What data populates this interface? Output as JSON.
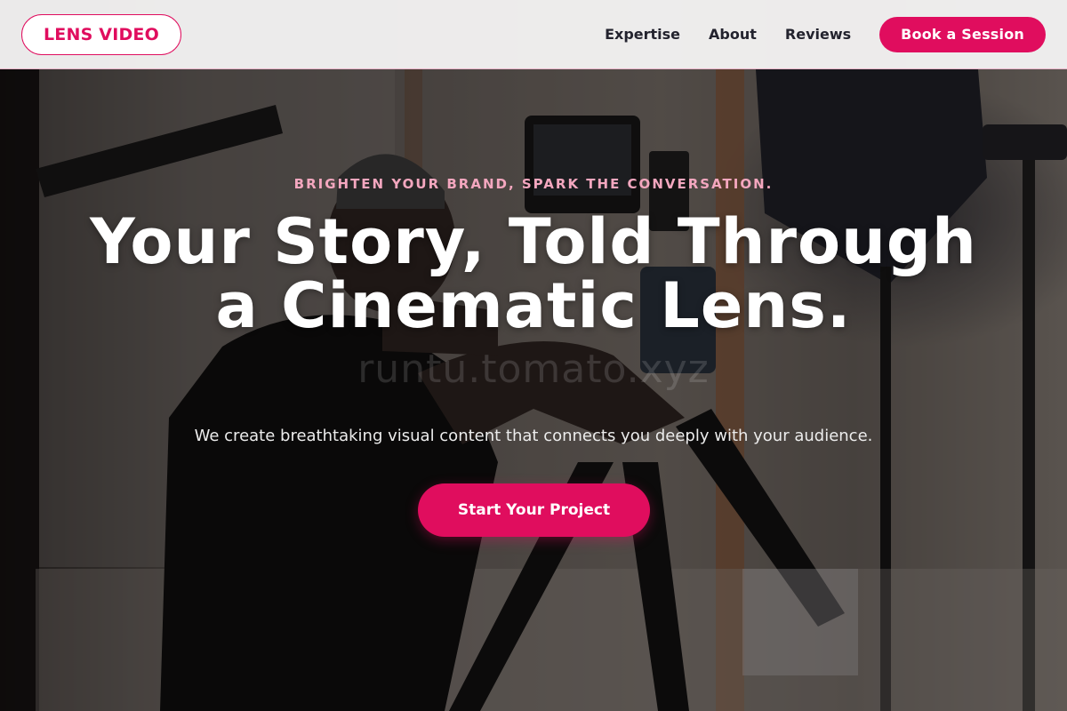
{
  "brand": {
    "logo_text": "LENS VIDEO",
    "accent_color": "#e00d5e"
  },
  "nav": {
    "links": [
      "Expertise",
      "About",
      "Reviews"
    ],
    "cta_label": "Book a Session"
  },
  "hero": {
    "tagline": "BRIGHTEN YOUR BRAND, SPARK THE CONVERSATION.",
    "headline": "Your Story, Told Through a Cinematic Lens.",
    "watermark": "runtu.tomato.xyz",
    "subtitle": "We create breathtaking visual content that connects you deeply with your audience.",
    "cta_label": "Start Your Project"
  }
}
